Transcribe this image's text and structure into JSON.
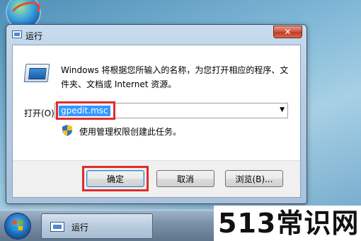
{
  "window": {
    "title": "运行",
    "close_glyph": "✕",
    "description": "Windows 将根据您所输入的名称，为您打开相应的程序、文件夹、文档或 Internet 资源。",
    "open_label": "打开(O):",
    "open_value": "gpedit.msc",
    "admin_note": "使用管理权限创建此任务。",
    "buttons": {
      "ok": "确定",
      "cancel": "取消",
      "browse": "浏览(B)..."
    }
  },
  "taskbar": {
    "task_label": "运行"
  },
  "watermark": "513常识网",
  "colors": {
    "highlight": "#e02b2b",
    "selection": "#3399ff",
    "close": "#c23b22"
  },
  "icons": [
    "app-globe-icon",
    "run-icon",
    "close-icon",
    "shield-icon",
    "windows-start-icon",
    "dropdown-arrow-icon"
  ]
}
